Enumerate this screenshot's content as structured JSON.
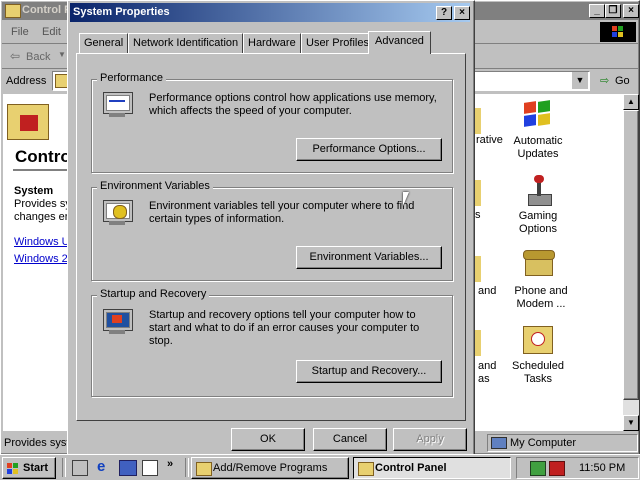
{
  "control_panel": {
    "title": "Control P",
    "menu": [
      "File",
      "Edit"
    ],
    "back_label": "Back",
    "address_label": "Address",
    "go_label": "Go",
    "heading": "Contro",
    "info_title": "System",
    "info_lines": [
      "Provides sy",
      "changes er"
    ],
    "links": [
      "Windows U",
      "Windows 2"
    ],
    "status_left": "Provides syst",
    "status_right": "My Computer",
    "icons": [
      {
        "label": "Automatic Updates",
        "icon": "windows-update-icon"
      },
      {
        "label": "Gaming Options",
        "icon": "joystick-icon"
      },
      {
        "label": "Phone and Modem ...",
        "icon": "phone-icon"
      },
      {
        "label": "Scheduled Tasks",
        "icon": "scheduled-tasks-icon"
      }
    ],
    "partial_icon_labels": [
      "rative",
      "and",
      "s",
      "and",
      "as"
    ]
  },
  "dialog": {
    "title": "System Properties",
    "help_glyph": "?",
    "close_glyph": "×",
    "tabs": [
      "General",
      "Network Identification",
      "Hardware",
      "User Profiles",
      "Advanced"
    ],
    "active_tab": "Advanced",
    "groups": [
      {
        "label": "Performance",
        "text": "Performance options control how applications use memory, which affects the speed of your computer.",
        "button": "Performance Options..."
      },
      {
        "label": "Environment Variables",
        "text": "Environment variables tell your computer where to find certain types of information.",
        "button": "Environment Variables..."
      },
      {
        "label": "Startup and Recovery",
        "text": "Startup and recovery options tell your computer how to start and what to do if an error causes your computer to stop.",
        "button": "Startup and Recovery..."
      }
    ],
    "ok_label": "OK",
    "cancel_label": "Cancel",
    "apply_label": "Apply"
  },
  "taskbar": {
    "start_label": "Start",
    "tasks": [
      "Add/Remove Programs",
      "Control Panel"
    ],
    "clock": "11:50 PM"
  }
}
